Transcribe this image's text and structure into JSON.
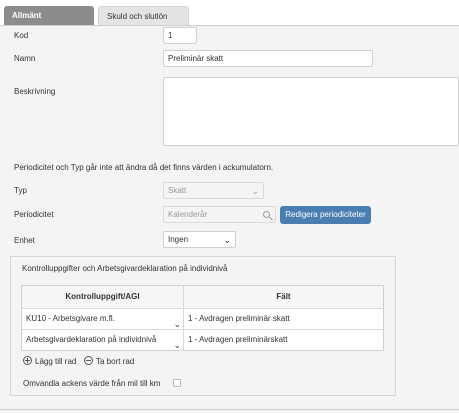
{
  "tabs": [
    {
      "label": "Allmänt",
      "active": true
    },
    {
      "label": "Skuld och slutlön",
      "active": false
    }
  ],
  "fields": {
    "kod": {
      "label": "Kod",
      "value": "1"
    },
    "namn": {
      "label": "Namn",
      "value": "Preliminär skatt"
    },
    "beskrivning": {
      "label": "Beskrivning",
      "value": ""
    },
    "info_text": "Periodicitet och Typ går inte att ändra då det finns värden i ackumulatorn.",
    "typ": {
      "label": "Typ",
      "value": "Skatt"
    },
    "periodicitet": {
      "label": "Periodicitet",
      "value": "Kalenderår",
      "button": "Redigera periodiciteter"
    },
    "enhet": {
      "label": "Enhet",
      "value": "Ingen"
    }
  },
  "panel": {
    "title": "Kontrolluppgifter och Arbetsgivardeklaration på individnivå",
    "columns": [
      "Kontrolluppgift/AGI",
      "Fält"
    ],
    "rows": [
      {
        "kontrolluppgift": "KU10 - Arbetsgivare m.fl.",
        "falt": "1 - Avdragen preliminär skatt"
      },
      {
        "kontrolluppgift": "Arbetsgivardeklaration på individnivå",
        "falt": "1 - Avdragen preliminärskatt"
      }
    ],
    "add_row": "Lägg till rad",
    "remove_row": "Ta bort rad",
    "convert_label": "Omvandla ackens värde från mil till km",
    "convert_checked": false
  },
  "colors": {
    "accent": "#4a7eb3",
    "tab_active": "#8c8c8c"
  }
}
